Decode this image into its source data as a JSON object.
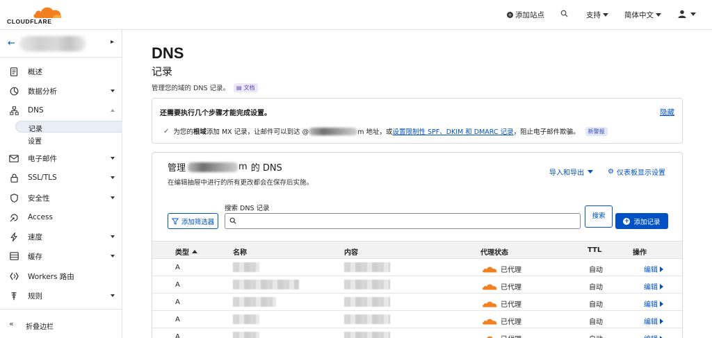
{
  "brand": {
    "logo_text": "CLOUDFLARE",
    "accent": "#f38020",
    "link_color": "#0051c3"
  },
  "topbar": {
    "add_site": "添加站点",
    "support": "支持",
    "language": "简体中文"
  },
  "sidebar": {
    "items": [
      {
        "label": "概述",
        "icon": "document-icon",
        "has_caret": false
      },
      {
        "label": "数据分析",
        "icon": "chart-icon",
        "has_caret": true
      },
      {
        "label": "DNS",
        "icon": "network-icon",
        "has_caret": true,
        "expanded": true
      },
      {
        "label": "电子邮件",
        "icon": "email-icon",
        "has_caret": true
      },
      {
        "label": "SSL/TLS",
        "icon": "lock-icon",
        "has_caret": true
      },
      {
        "label": "安全性",
        "icon": "shield-icon",
        "has_caret": true
      },
      {
        "label": "Access",
        "icon": "access-icon",
        "has_caret": false
      },
      {
        "label": "速度",
        "icon": "lightning-icon",
        "has_caret": true
      },
      {
        "label": "缓存",
        "icon": "storage-icon",
        "has_caret": true
      },
      {
        "label": "Workers 路由",
        "icon": "workers-icon",
        "has_caret": false
      },
      {
        "label": "规则",
        "icon": "rules-icon",
        "has_caret": true
      }
    ],
    "dns_sub": [
      "记录",
      "设置"
    ],
    "collapse_label": "折叠边栏"
  },
  "page": {
    "title": "DNS",
    "subtitle": "记录",
    "description": "管理您的域的 DNS 记录。",
    "doc_badge": "文档"
  },
  "banner": {
    "title": "还需要执行几个步骤才能完成设置。",
    "hide": "隐藏",
    "line_prefix": "为您的",
    "line_bold": "根域",
    "line_mid": "添加 MX 记录，让邮件可以到达 @",
    "line_domain_tail": "m 地址，或",
    "line_link": "设置限制性 SPF、DKIM 和 DMARC 记录",
    "line_suffix": "，阻止电子邮件欺骗。",
    "new_badge": "新警报"
  },
  "records_card": {
    "title_prefix": "管理",
    "title_domain_tail": "m",
    "title_suffix": "的 DNS",
    "subtitle": "在编辑抽屉中进行的所有更改都会在保存后实施。",
    "import_export": "导入和导出",
    "dashboard_settings": "仪表板显示设置",
    "filter_button": "添加筛选器",
    "search_label": "搜索 DNS 记录",
    "search_value": "",
    "search_button": "搜索",
    "add_record": "添加记录",
    "columns": [
      "类型",
      "名称",
      "内容",
      "代理状态",
      "TTL",
      "操作"
    ],
    "rows": [
      {
        "type": "A",
        "proxy": "已代理",
        "ttl": "自动",
        "action": "编辑"
      },
      {
        "type": "A",
        "proxy": "已代理",
        "ttl": "自动",
        "action": "编辑"
      },
      {
        "type": "A",
        "proxy": "已代理",
        "ttl": "自动",
        "action": "编辑"
      },
      {
        "type": "A",
        "proxy": "已代理",
        "ttl": "自动",
        "action": "编辑"
      },
      {
        "type": "A",
        "proxy": "已代理",
        "ttl": "自动",
        "action": "编辑"
      }
    ]
  }
}
